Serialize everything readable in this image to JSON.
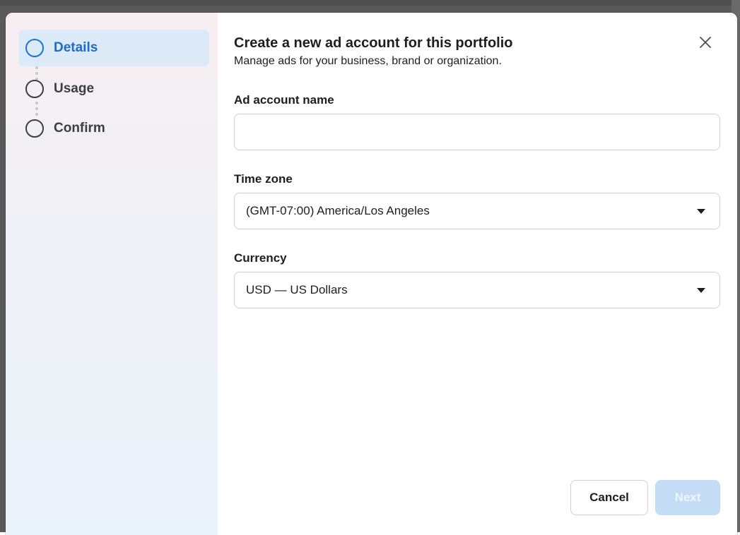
{
  "sidebar": {
    "steps": [
      {
        "label": "Details",
        "state": "active"
      },
      {
        "label": "Usage",
        "state": "pending"
      },
      {
        "label": "Confirm",
        "state": "pending"
      }
    ]
  },
  "dialog": {
    "title": "Create a new ad account for this portfolio",
    "subtitle": "Manage ads for your business, brand or organization.",
    "close_icon": "close-icon"
  },
  "form": {
    "ad_account_name": {
      "label": "Ad account name",
      "value": "",
      "placeholder": ""
    },
    "time_zone": {
      "label": "Time zone",
      "value": "(GMT-07:00) America/Los Angeles"
    },
    "currency": {
      "label": "Currency",
      "value": "USD — US Dollars"
    }
  },
  "footer": {
    "cancel_label": "Cancel",
    "next_label": "Next"
  },
  "colors": {
    "accent": "#1877d2",
    "active_step_bg": "#dce9f7",
    "next_disabled_bg": "#c5dcf6",
    "text": "#1c1e21"
  }
}
